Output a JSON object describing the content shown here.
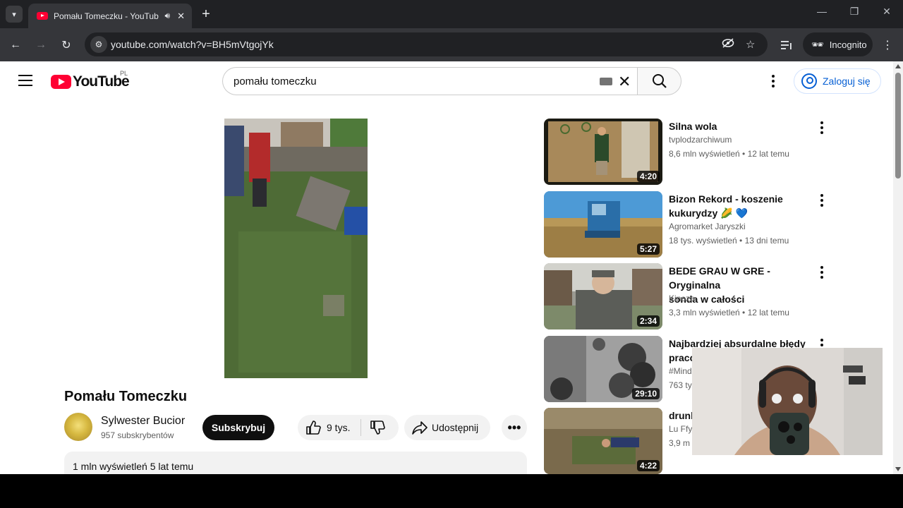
{
  "browser": {
    "tab_title": "Pomału Tomeczku - YouTub",
    "tab_menu_icon": "chevron-down-icon",
    "new_tab_icon": "plus-icon",
    "url": "youtube.com/watch?v=BH5mVtgojYk",
    "incognito_label": "Incognito",
    "controls": {
      "minimize": "—",
      "restore": "❐",
      "close": "✕"
    }
  },
  "masthead": {
    "logo_text": "YouTube",
    "country_code": "PL",
    "search_value": "pomału tomeczku",
    "signin_label": "Zaloguj się"
  },
  "video": {
    "title": "Pomału Tomeczku",
    "channel": "Sylwester Bucior",
    "subscribers": "957 subskrybentów",
    "subscribe_label": "Subskrybuj",
    "likes": "9 tys.",
    "share_label": "Udostępnij",
    "views_date": "1 mln wyświetleń  5 lat temu"
  },
  "recommendations": [
    {
      "title_lines": [
        "Silna wola"
      ],
      "channel": "tvplodzarchiwum",
      "meta": "8,6 mln wyświetleń • 12 lat temu",
      "duration": "4:20"
    },
    {
      "title_lines": [
        "Bizon Rekord - koszenie",
        "kukurydzy 🌽 💙"
      ],
      "channel": "Agromarket Jaryszki",
      "meta": "18 tys. wyświetleń • 13 dni temu",
      "duration": "5:27"
    },
    {
      "title_lines": [
        "BEDE GRAU W GRE - Oryginalna",
        "sonda w całości"
      ],
      "channel": "Kinoza",
      "meta": "3,3 mln wyświetleń • 12 lat temu",
      "duration": "2:34"
    },
    {
      "title_lines": [
        "Najbardziej absurdalne błędy",
        "pracc"
      ],
      "channel": "#Mind",
      "meta": "763 ty",
      "duration": "29:10"
    },
    {
      "title_lines": [
        "drunk"
      ],
      "channel": "Lu Ffy",
      "meta": "3,9 m",
      "duration": "4:22"
    }
  ],
  "colors": {
    "youtube_red": "#ff0033",
    "link_blue": "#065fd4",
    "chrome_dark": "#202124",
    "chrome_toolbar": "#35363a"
  }
}
